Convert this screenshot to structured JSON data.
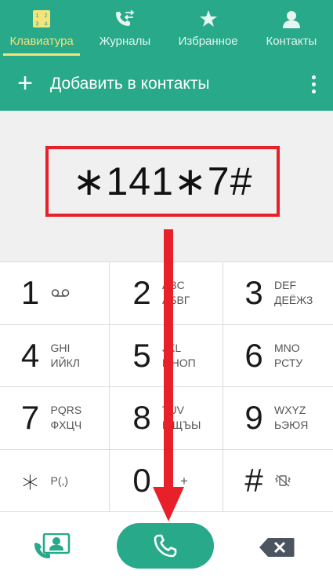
{
  "tabs": [
    {
      "label": "Клавиатура",
      "icon": "dialpad-icon",
      "active": true
    },
    {
      "label": "Журналы",
      "icon": "call-log-icon",
      "active": false
    },
    {
      "label": "Избранное",
      "icon": "star-icon",
      "active": false
    },
    {
      "label": "Контакты",
      "icon": "contact-person-icon",
      "active": false
    }
  ],
  "actionbar": {
    "add_icon": "+",
    "add_label": "Добавить в контакты",
    "more_icon": "more-vertical-icon"
  },
  "display": {
    "number": "∗141∗7#",
    "highlight_color": "#e8202a"
  },
  "keypad": [
    {
      "digit": "1",
      "l1": "",
      "l2": "",
      "icon": "voicemail-icon"
    },
    {
      "digit": "2",
      "l1": "ABC",
      "l2": "АБВГ"
    },
    {
      "digit": "3",
      "l1": "DEF",
      "l2": "ДЕЁЖЗ"
    },
    {
      "digit": "4",
      "l1": "GHI",
      "l2": "ИЙКЛ"
    },
    {
      "digit": "5",
      "l1": "JKL",
      "l2": "МНОП"
    },
    {
      "digit": "6",
      "l1": "MNO",
      "l2": "РСТУ"
    },
    {
      "digit": "7",
      "l1": "PQRS",
      "l2": "ФХЦЧ"
    },
    {
      "digit": "8",
      "l1": "TUV",
      "l2": "ШЩЪЫ"
    },
    {
      "digit": "9",
      "l1": "WXYZ",
      "l2": "ЬЭЮЯ"
    },
    {
      "digit": "∗",
      "l1": "P(,)",
      "l2": ""
    },
    {
      "digit": "0",
      "l1": "+",
      "l2": ""
    },
    {
      "digit": "#",
      "l1": "",
      "l2": "",
      "icon": "vibrate-off-icon"
    }
  ],
  "bottombar": {
    "contacts_icon": "contacts-card-icon",
    "call_icon": "phone-icon",
    "delete_icon": "backspace-icon"
  },
  "colors": {
    "primary": "#27a98a",
    "active_tab": "#f5e47a",
    "annotation": "#e8202a"
  }
}
